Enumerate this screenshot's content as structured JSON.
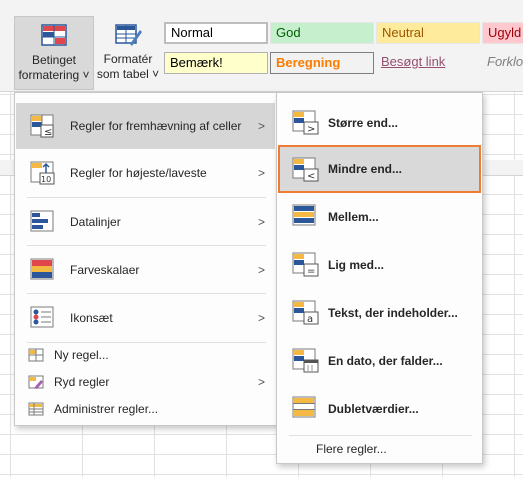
{
  "ribbon": {
    "conditional_formatting": {
      "line1": "Betinget",
      "line2": "formatering ˅"
    },
    "format_as_table": {
      "line1": "Formatér",
      "line2": "som tabel ˅"
    },
    "styles": {
      "normal": "Normal",
      "good": "God",
      "neutral": "Neutral",
      "bad": "Ugyld",
      "note": "Bemærk!",
      "calculation": "Beregning",
      "visited_link": "Besøgt link",
      "explanatory": "Forklo"
    }
  },
  "menu": {
    "items": [
      {
        "label": "Regler for fremhævning af celler",
        "icon": "highlight-cells-icon",
        "has_submenu": true,
        "selected": true
      },
      {
        "label": "Regler for højeste/laveste",
        "icon": "top-bottom-icon",
        "has_submenu": true
      },
      {
        "label": "Datalinjer",
        "icon": "data-bars-icon",
        "has_submenu": true
      },
      {
        "label": "Farveskalaer",
        "icon": "color-scales-icon",
        "has_submenu": true
      },
      {
        "label": "Ikonsæt",
        "icon": "icon-sets-icon",
        "has_submenu": true
      }
    ],
    "small_items": [
      {
        "label": "Ny regel...",
        "icon": "new-rule-icon",
        "has_submenu": false
      },
      {
        "label": "Ryd regler",
        "icon": "clear-rules-icon",
        "has_submenu": true
      },
      {
        "label": "Administrer regler...",
        "icon": "manage-rules-icon",
        "has_submenu": false
      }
    ]
  },
  "submenu": {
    "items": [
      {
        "label": "Større end...",
        "icon": "greater-than-icon"
      },
      {
        "label": "Mindre end...",
        "icon": "less-than-icon",
        "focused": true
      },
      {
        "label": "Mellem...",
        "icon": "between-icon"
      },
      {
        "label": "Lig med...",
        "icon": "equal-to-icon"
      },
      {
        "label": "Tekst, der indeholder...",
        "icon": "text-contains-icon"
      },
      {
        "label": "En dato, der falder...",
        "icon": "date-occurring-icon"
      },
      {
        "label": "Dubletværdier...",
        "icon": "duplicate-values-icon"
      }
    ],
    "more_rules": "Flere regler..."
  },
  "colors": {
    "focus_border": "#ed7d31",
    "selected_bg": "#d6d6d6",
    "icon_blue": "#2b579a",
    "icon_red": "#e0474c",
    "icon_yellow": "#f4b942"
  }
}
